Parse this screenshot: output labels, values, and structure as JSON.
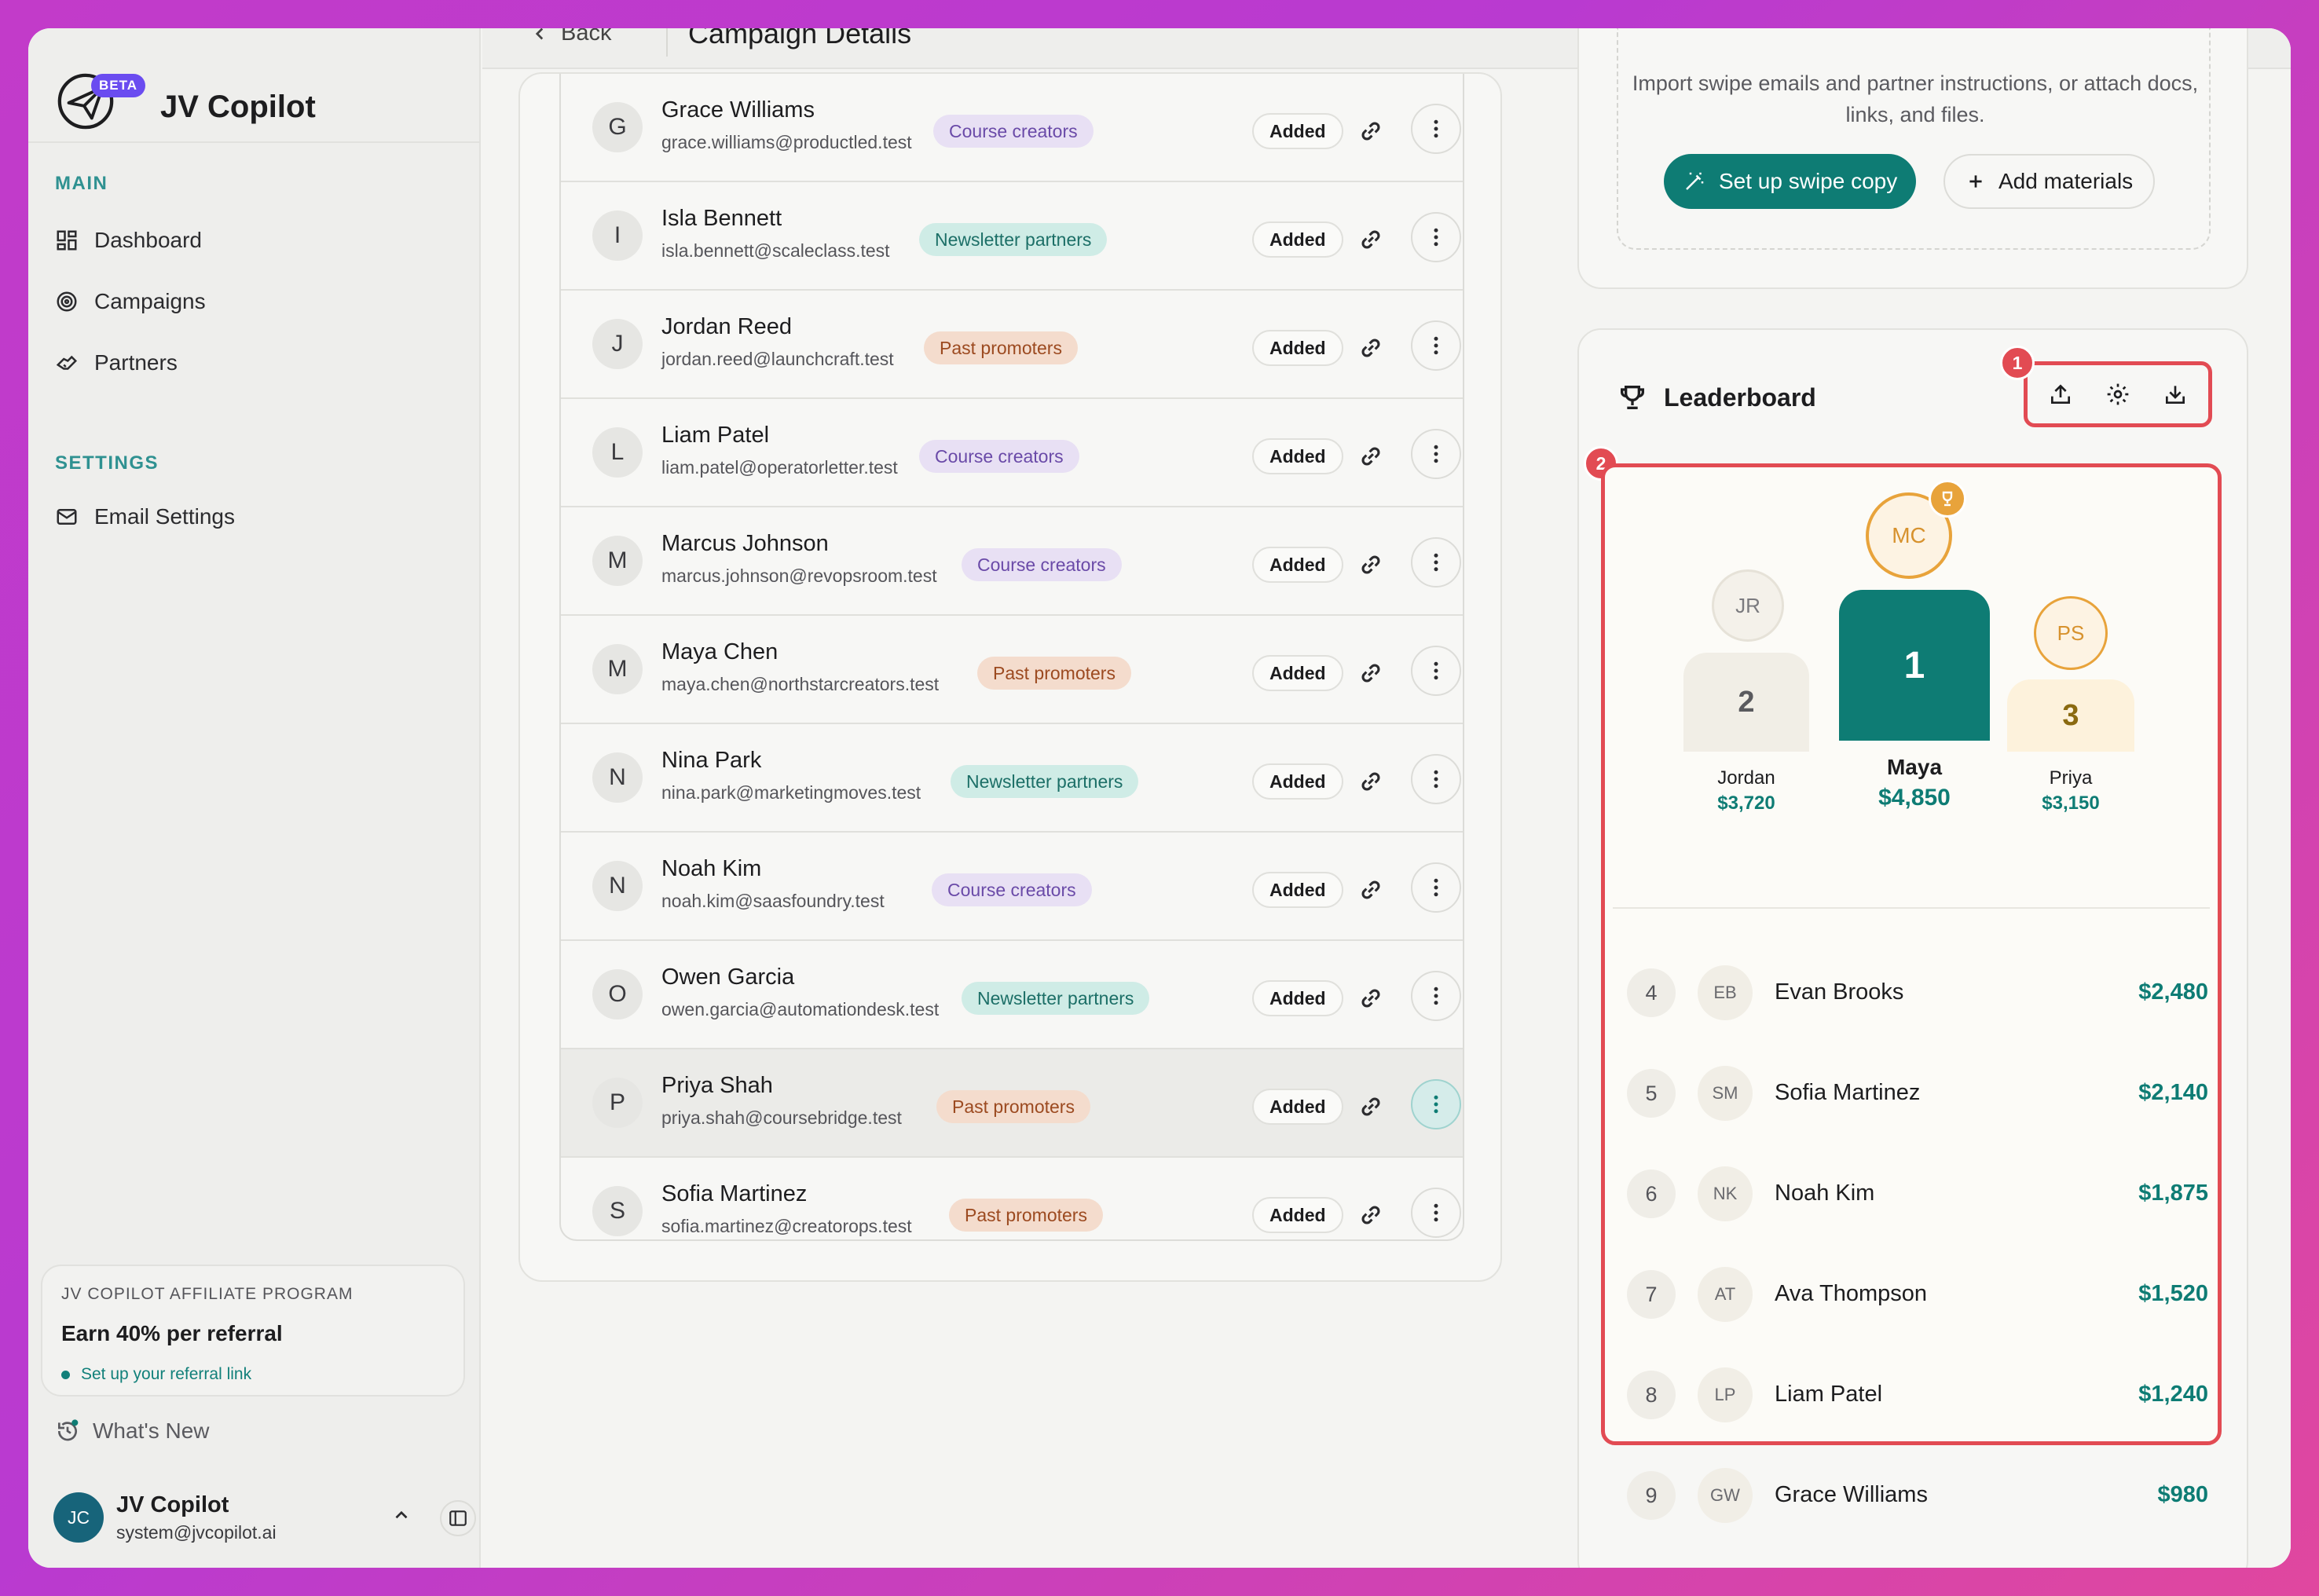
{
  "brand": {
    "name": "JV Copilot",
    "badge": "BETA"
  },
  "sidebar": {
    "main_label": "MAIN",
    "main_items": [
      {
        "label": "Dashboard",
        "icon": "grid-icon"
      },
      {
        "label": "Campaigns",
        "icon": "target-icon"
      },
      {
        "label": "Partners",
        "icon": "handshake-icon"
      }
    ],
    "settings_label": "SETTINGS",
    "settings_items": [
      {
        "label": "Email Settings",
        "icon": "mail-icon"
      }
    ],
    "affiliate": {
      "kicker": "JV COPILOT AFFILIATE PROGRAM",
      "title": "Earn 40% per referral",
      "link": "Set up your referral link"
    },
    "whats_new": "What's New",
    "user": {
      "initials": "JC",
      "name": "JV Copilot",
      "email": "system@jvcopilot.ai"
    }
  },
  "header": {
    "back": "Back",
    "title": "Campaign Details"
  },
  "partners": [
    {
      "initial": "G",
      "name": "Grace Williams",
      "email": "grace.williams@productled.test",
      "tag": "Course creators",
      "tag_type": "course",
      "status": "Added"
    },
    {
      "initial": "I",
      "name": "Isla Bennett",
      "email": "isla.bennett@scaleclass.test",
      "tag": "Newsletter partners",
      "tag_type": "news",
      "status": "Added"
    },
    {
      "initial": "J",
      "name": "Jordan Reed",
      "email": "jordan.reed@launchcraft.test",
      "tag": "Past promoters",
      "tag_type": "past",
      "status": "Added"
    },
    {
      "initial": "L",
      "name": "Liam Patel",
      "email": "liam.patel@operatorletter.test",
      "tag": "Course creators",
      "tag_type": "course",
      "status": "Added"
    },
    {
      "initial": "M",
      "name": "Marcus Johnson",
      "email": "marcus.johnson@revopsroom.test",
      "tag": "Course creators",
      "tag_type": "course",
      "status": "Added"
    },
    {
      "initial": "M",
      "name": "Maya Chen",
      "email": "maya.chen@northstarcreators.test",
      "tag": "Past promoters",
      "tag_type": "past",
      "status": "Added"
    },
    {
      "initial": "N",
      "name": "Nina Park",
      "email": "nina.park@marketingmoves.test",
      "tag": "Newsletter partners",
      "tag_type": "news",
      "status": "Added"
    },
    {
      "initial": "N",
      "name": "Noah Kim",
      "email": "noah.kim@saasfoundry.test",
      "tag": "Course creators",
      "tag_type": "course",
      "status": "Added"
    },
    {
      "initial": "O",
      "name": "Owen Garcia",
      "email": "owen.garcia@automationdesk.test",
      "tag": "Newsletter partners",
      "tag_type": "news",
      "status": "Added"
    },
    {
      "initial": "P",
      "name": "Priya Shah",
      "email": "priya.shah@coursebridge.test",
      "tag": "Past promoters",
      "tag_type": "past",
      "status": "Added",
      "active": true
    },
    {
      "initial": "S",
      "name": "Sofia Martinez",
      "email": "sofia.martinez@creatorops.test",
      "tag": "Past promoters",
      "tag_type": "past",
      "status": "Added"
    }
  ],
  "materials": {
    "description": "Import swipe emails and partner instructions, or attach docs, links, and files.",
    "primary_button": "Set up swipe copy",
    "secondary_button": "Add materials"
  },
  "leaderboard": {
    "title": "Leaderboard",
    "annotations": [
      "1",
      "2"
    ],
    "podium": [
      {
        "rank": "2",
        "initials": "JR",
        "name": "Jordan",
        "amount": "$3,720"
      },
      {
        "rank": "1",
        "initials": "MC",
        "name": "Maya",
        "amount": "$4,850"
      },
      {
        "rank": "3",
        "initials": "PS",
        "name": "Priya",
        "amount": "$3,150"
      }
    ],
    "rows": [
      {
        "rank": "4",
        "initials": "EB",
        "name": "Evan Brooks",
        "amount": "$2,480"
      },
      {
        "rank": "5",
        "initials": "SM",
        "name": "Sofia Martinez",
        "amount": "$2,140"
      },
      {
        "rank": "6",
        "initials": "NK",
        "name": "Noah Kim",
        "amount": "$1,875"
      },
      {
        "rank": "7",
        "initials": "AT",
        "name": "Ava Thompson",
        "amount": "$1,520"
      },
      {
        "rank": "8",
        "initials": "LP",
        "name": "Liam Patel",
        "amount": "$1,240"
      },
      {
        "rank": "9",
        "initials": "GW",
        "name": "Grace Williams",
        "amount": "$980"
      }
    ]
  },
  "colors": {
    "accent": "#0e7c74",
    "annotation": "#e24b53",
    "gold": "#e8a33b"
  }
}
